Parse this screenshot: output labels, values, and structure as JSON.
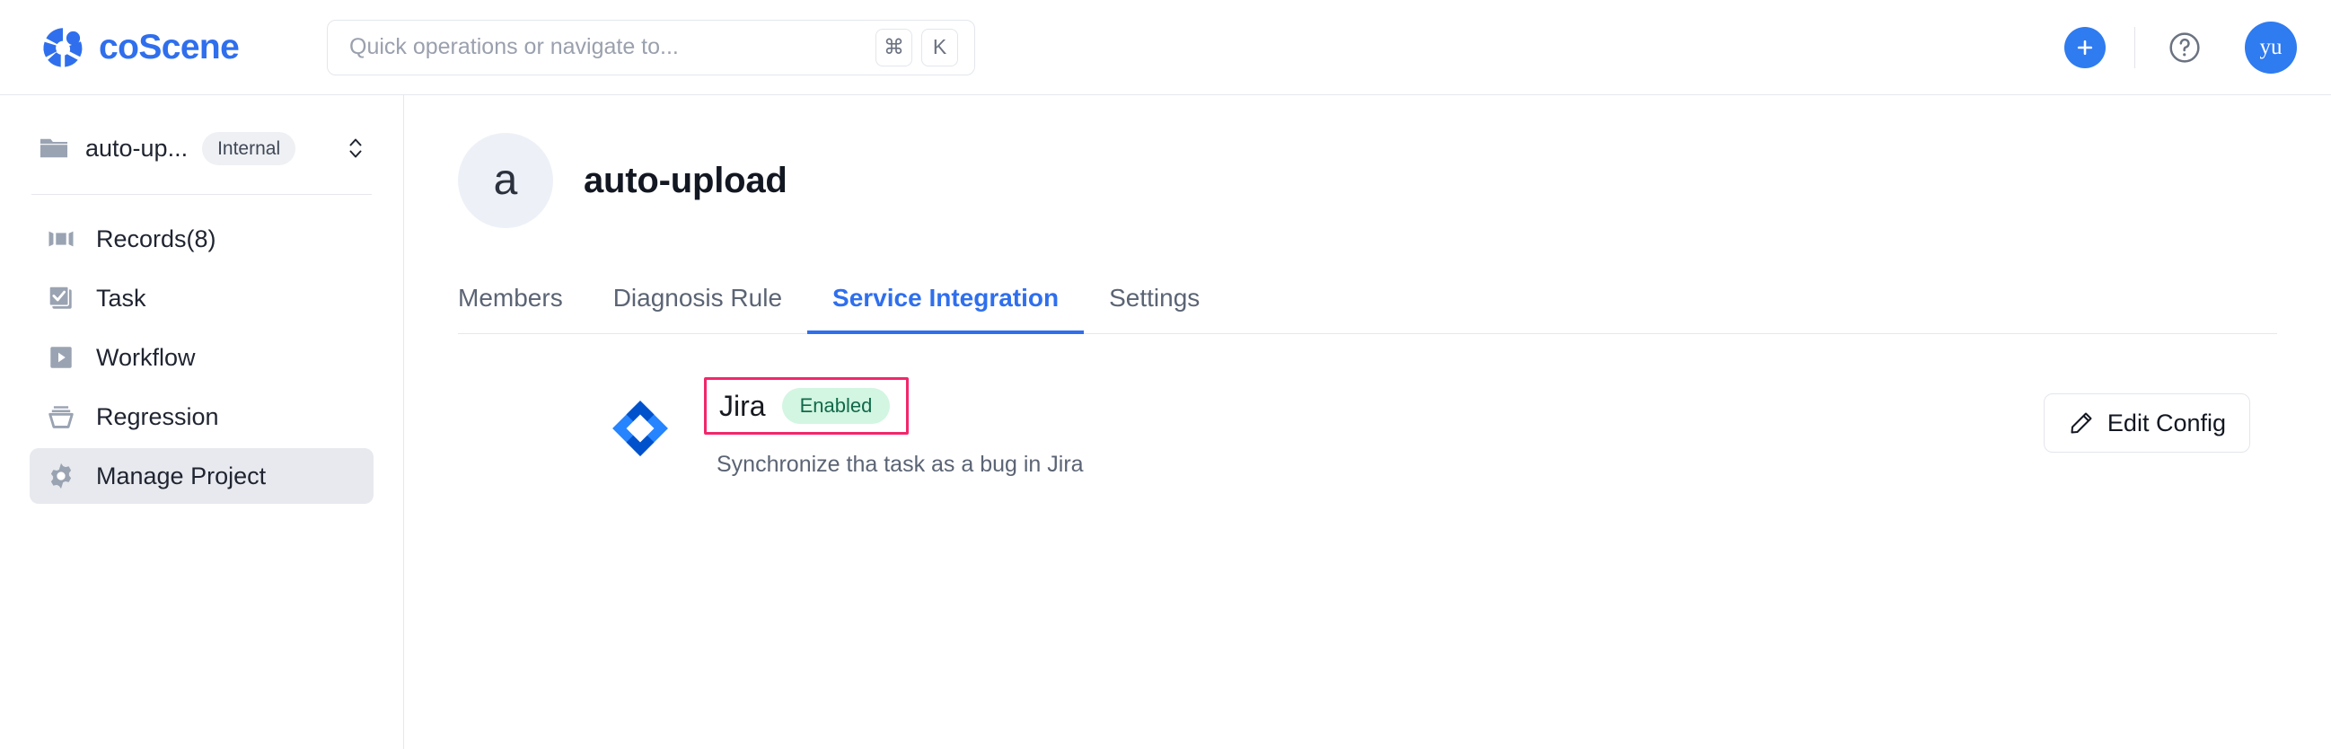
{
  "topbar": {
    "brand_name": "coScene",
    "brand_icon": "coscene-logo-icon",
    "search": {
      "placeholder": "Quick operations or navigate to...",
      "value": "",
      "shortcut_keys": [
        "⌘",
        "K"
      ]
    },
    "add_icon": "plus-icon",
    "help_icon": "question-circle-icon",
    "avatar_initials": "yu"
  },
  "sidebar": {
    "project_switcher": {
      "icon": "folder-icon",
      "name": "auto-up...",
      "badge": "Internal",
      "chevron_icon": "chevron-up-down-icon"
    },
    "items": [
      {
        "label": "Records(8)",
        "icon": "records-film-icon",
        "active": false
      },
      {
        "label": "Task",
        "icon": "check-square-icon",
        "active": false
      },
      {
        "label": "Workflow",
        "icon": "play-square-icon",
        "active": false
      },
      {
        "label": "Regression",
        "icon": "funnel-icon",
        "active": false
      },
      {
        "label": "Manage Project",
        "icon": "gear-icon",
        "active": true
      }
    ]
  },
  "main": {
    "project_avatar_initial": "a",
    "project_title": "auto-upload",
    "tabs": [
      {
        "label": "Members",
        "active": false
      },
      {
        "label": "Diagnosis Rule",
        "active": false
      },
      {
        "label": "Service Integration",
        "active": true
      },
      {
        "label": "Settings",
        "active": false
      }
    ],
    "integrations": [
      {
        "logo_icon": "jira-logo-icon",
        "name": "Jira",
        "status": "Enabled",
        "description": "Synchronize tha task as a bug in Jira",
        "action_label": "Edit Config",
        "action_icon": "pencil-icon",
        "highlighted": true
      }
    ]
  },
  "colors": {
    "brand_blue": "#2f6fed",
    "accent_blue": "#2f7bf0",
    "active_tab_blue": "#2f6fed",
    "status_badge_bg": "#d2f6e1",
    "status_badge_text": "#11694a",
    "annotation_pink": "#f2276b",
    "sidebar_active_bg": "#e7e9ee",
    "border_gray": "#e6e8ec",
    "muted_text": "#5b6474",
    "icon_gray": "#9aa3b2",
    "jira_blue_light": "#2684ff",
    "jira_blue_dark": "#0052cc"
  }
}
